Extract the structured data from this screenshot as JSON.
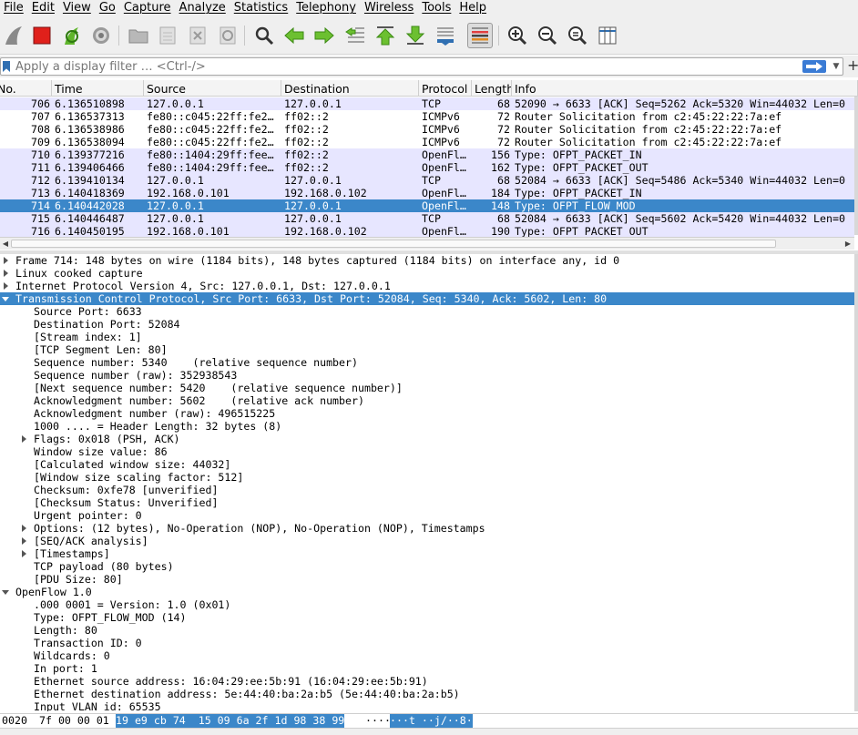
{
  "menu": [
    "File",
    "Edit",
    "View",
    "Go",
    "Capture",
    "Analyze",
    "Statistics",
    "Telephony",
    "Wireless",
    "Tools",
    "Help"
  ],
  "toolbar": {
    "icons": [
      "shark-fin-icon",
      "stop-capture-icon",
      "restart-capture-icon",
      "capture-options-icon",
      "open-file-icon",
      "save-file-icon",
      "close-file-icon",
      "reload-file-icon",
      "find-packet-icon",
      "go-back-icon",
      "go-forward-icon",
      "go-to-packet-icon",
      "first-packet-icon",
      "last-packet-icon",
      "autoscroll-icon",
      "colorize-icon",
      "zoom-in-icon",
      "zoom-out-icon",
      "zoom-reset-icon",
      "resize-columns-icon"
    ]
  },
  "filter": {
    "placeholder": "Apply a display filter … <Ctrl-/>"
  },
  "packet_list": {
    "columns": [
      "No.",
      "Time",
      "Source",
      "Destination",
      "Protocol",
      "Length",
      "Info"
    ],
    "rows": [
      {
        "no": "706",
        "time": "6.136510898",
        "src": "127.0.0.1",
        "dst": "127.0.0.1",
        "proto": "TCP",
        "len": "68",
        "info": "52090 → 6633 [ACK] Seq=5262 Ack=5320 Win=44032 Len=0",
        "kind": "tcp"
      },
      {
        "no": "707",
        "time": "6.136537313",
        "src": "fe80::c045:22ff:fe2…",
        "dst": "ff02::2",
        "proto": "ICMPv6",
        "len": "72",
        "info": "Router Solicitation from c2:45:22:22:7a:ef",
        "kind": "icmp"
      },
      {
        "no": "708",
        "time": "6.136538986",
        "src": "fe80::c045:22ff:fe2…",
        "dst": "ff02::2",
        "proto": "ICMPv6",
        "len": "72",
        "info": "Router Solicitation from c2:45:22:22:7a:ef",
        "kind": "icmp"
      },
      {
        "no": "709",
        "time": "6.136538094",
        "src": "fe80::c045:22ff:fe2…",
        "dst": "ff02::2",
        "proto": "ICMPv6",
        "len": "72",
        "info": "Router Solicitation from c2:45:22:22:7a:ef",
        "kind": "icmp"
      },
      {
        "no": "710",
        "time": "6.139377216",
        "src": "fe80::1404:29ff:fee…",
        "dst": "ff02::2",
        "proto": "OpenFl…",
        "len": "156",
        "info": "Type: OFPT_PACKET_IN",
        "kind": "of"
      },
      {
        "no": "711",
        "time": "6.139406466",
        "src": "fe80::1404:29ff:fee…",
        "dst": "ff02::2",
        "proto": "OpenFl…",
        "len": "162",
        "info": "Type: OFPT_PACKET_OUT",
        "kind": "of"
      },
      {
        "no": "712",
        "time": "6.139410134",
        "src": "127.0.0.1",
        "dst": "127.0.0.1",
        "proto": "TCP",
        "len": "68",
        "info": "52084 → 6633 [ACK] Seq=5486 Ack=5340 Win=44032 Len=0",
        "kind": "tcp"
      },
      {
        "no": "713",
        "time": "6.140418369",
        "src": "192.168.0.101",
        "dst": "192.168.0.102",
        "proto": "OpenFl…",
        "len": "184",
        "info": "Type: OFPT_PACKET_IN",
        "kind": "of"
      },
      {
        "no": "714",
        "time": "6.140442028",
        "src": "127.0.0.1",
        "dst": "127.0.0.1",
        "proto": "OpenFl…",
        "len": "148",
        "info": "Type: OFPT_FLOW_MOD",
        "kind": "sel"
      },
      {
        "no": "715",
        "time": "6.140446487",
        "src": "127.0.0.1",
        "dst": "127.0.0.1",
        "proto": "TCP",
        "len": "68",
        "info": "52084 → 6633 [ACK] Seq=5602 Ack=5420 Win=44032 Len=0",
        "kind": "tcp"
      },
      {
        "no": "716",
        "time": "6.140450195",
        "src": "192.168.0.101",
        "dst": "192.168.0.102",
        "proto": "OpenFl…",
        "len": "190",
        "info": "Type: OFPT_PACKET_OUT",
        "kind": "of"
      }
    ]
  },
  "details": [
    {
      "text": "Frame 714: 148 bytes on wire (1184 bits), 148 bytes captured (1184 bits) on interface any, id 0",
      "level": 0,
      "arrow": "right"
    },
    {
      "text": "Linux cooked capture",
      "level": 0,
      "arrow": "right"
    },
    {
      "text": "Internet Protocol Version 4, Src: 127.0.0.1, Dst: 127.0.0.1",
      "level": 0,
      "arrow": "right"
    },
    {
      "text": "Transmission Control Protocol, Src Port: 6633, Dst Port: 52084, Seq: 5340, Ack: 5602, Len: 80",
      "level": 0,
      "arrow": "down",
      "selected": true
    },
    {
      "text": "Source Port: 6633",
      "level": 1
    },
    {
      "text": "Destination Port: 52084",
      "level": 1
    },
    {
      "text": "[Stream index: 1]",
      "level": 1
    },
    {
      "text": "[TCP Segment Len: 80]",
      "level": 1
    },
    {
      "text": "Sequence number: 5340    (relative sequence number)",
      "level": 1
    },
    {
      "text": "Sequence number (raw): 352938543",
      "level": 1
    },
    {
      "text": "[Next sequence number: 5420    (relative sequence number)]",
      "level": 1
    },
    {
      "text": "Acknowledgment number: 5602    (relative ack number)",
      "level": 1
    },
    {
      "text": "Acknowledgment number (raw): 496515225",
      "level": 1
    },
    {
      "text": "1000 .... = Header Length: 32 bytes (8)",
      "level": 1
    },
    {
      "text": "Flags: 0x018 (PSH, ACK)",
      "level": 1,
      "arrow": "right"
    },
    {
      "text": "Window size value: 86",
      "level": 1
    },
    {
      "text": "[Calculated window size: 44032]",
      "level": 1
    },
    {
      "text": "[Window size scaling factor: 512]",
      "level": 1
    },
    {
      "text": "Checksum: 0xfe78 [unverified]",
      "level": 1
    },
    {
      "text": "[Checksum Status: Unverified]",
      "level": 1
    },
    {
      "text": "Urgent pointer: 0",
      "level": 1
    },
    {
      "text": "Options: (12 bytes), No-Operation (NOP), No-Operation (NOP), Timestamps",
      "level": 1,
      "arrow": "right"
    },
    {
      "text": "[SEQ/ACK analysis]",
      "level": 1,
      "arrow": "right"
    },
    {
      "text": "[Timestamps]",
      "level": 1,
      "arrow": "right"
    },
    {
      "text": "TCP payload (80 bytes)",
      "level": 1
    },
    {
      "text": "[PDU Size: 80]",
      "level": 1
    },
    {
      "text": "OpenFlow 1.0",
      "level": 0,
      "arrow": "down"
    },
    {
      "text": ".000 0001 = Version: 1.0 (0x01)",
      "level": 1
    },
    {
      "text": "Type: OFPT_FLOW_MOD (14)",
      "level": 1
    },
    {
      "text": "Length: 80",
      "level": 1
    },
    {
      "text": "Transaction ID: 0",
      "level": 1
    },
    {
      "text": "Wildcards: 0",
      "level": 1
    },
    {
      "text": "In port: 1",
      "level": 1
    },
    {
      "text": "Ethernet source address: 16:04:29:ee:5b:91 (16:04:29:ee:5b:91)",
      "level": 1
    },
    {
      "text": "Ethernet destination address: 5e:44:40:ba:2a:b5 (5e:44:40:ba:2a:b5)",
      "level": 1
    },
    {
      "text": "Input VLAN id: 65535",
      "level": 1
    }
  ],
  "hex": {
    "offset": "0020",
    "plain_bytes": "7f 00 00 01",
    "selected_bytes": "19 e9 cb 74  15 09 6a 2f 1d 98 38 99",
    "plain_ascii": "····",
    "selected_ascii": "···t ··j/··8·"
  },
  "colors": {
    "selection": "#3b87c9",
    "tcp_row": "#e7e6ff",
    "openflow_row": "#e7e6ff",
    "stop_red": "#e0201b",
    "arrow_green": "#5fb52b"
  }
}
